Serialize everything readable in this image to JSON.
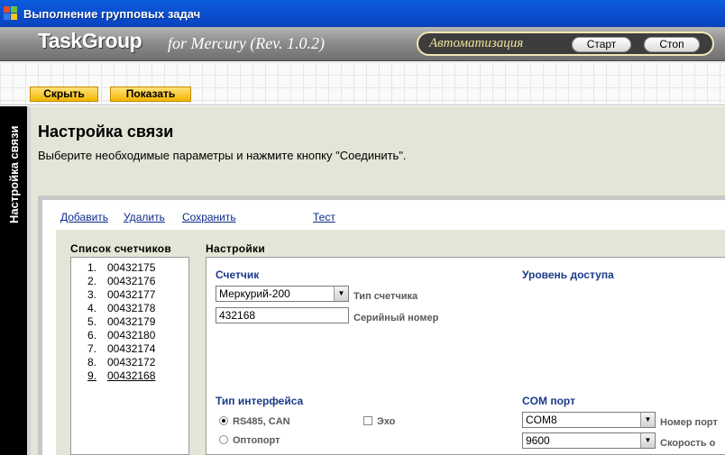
{
  "window": {
    "title": "Выполнение групповых задач"
  },
  "header": {
    "logo": "TaskGroup",
    "product": "for Mercury (Rev. 1.0.2)",
    "automation_label": "Автоматизация",
    "start_label": "Старт",
    "stop_label": "Стоп"
  },
  "toolbar": {
    "hide_label": "Скрыть",
    "show_label": "Показать"
  },
  "sidebar": {
    "tab_label": "Настройка связи"
  },
  "page": {
    "title": "Настройка связи",
    "description": "Выберите необходимые параметры и нажмите кнопку \"Соединить\"."
  },
  "actions": {
    "add": "Добавить",
    "delete": "Удалить",
    "save": "Сохранить",
    "test": "Тест"
  },
  "meters": {
    "title": "Список счетчиков",
    "items": [
      {
        "num": "1.",
        "value": "00432175"
      },
      {
        "num": "2.",
        "value": "00432176"
      },
      {
        "num": "3.",
        "value": "00432177"
      },
      {
        "num": "4.",
        "value": "00432178"
      },
      {
        "num": "5.",
        "value": "00432179"
      },
      {
        "num": "6.",
        "value": "00432180"
      },
      {
        "num": "7.",
        "value": "00432174"
      },
      {
        "num": "8.",
        "value": "00432172"
      },
      {
        "num": "9.",
        "value": "00432168"
      }
    ],
    "selected_index": 8
  },
  "settings": {
    "title": "Настройки",
    "meter_section": "Счетчик",
    "meter_type_value": "Меркурий-200",
    "meter_type_hint": "Тип счетчика",
    "serial_value": "432168",
    "serial_hint": "Серийный номер",
    "access_section": "Уровень доступа",
    "interface_section": "Тип интерфейса",
    "interface_rs485": "RS485, CAN",
    "interface_optoport": "Оптопорт",
    "interface_selected": "RS485, CAN",
    "echo_label": "Эхо",
    "echo_checked": false,
    "com_section": "COM порт",
    "com_port_value": "COM8",
    "com_port_hint": "Номер порт",
    "baud_value": "9600",
    "baud_hint": "Скорость о"
  }
}
